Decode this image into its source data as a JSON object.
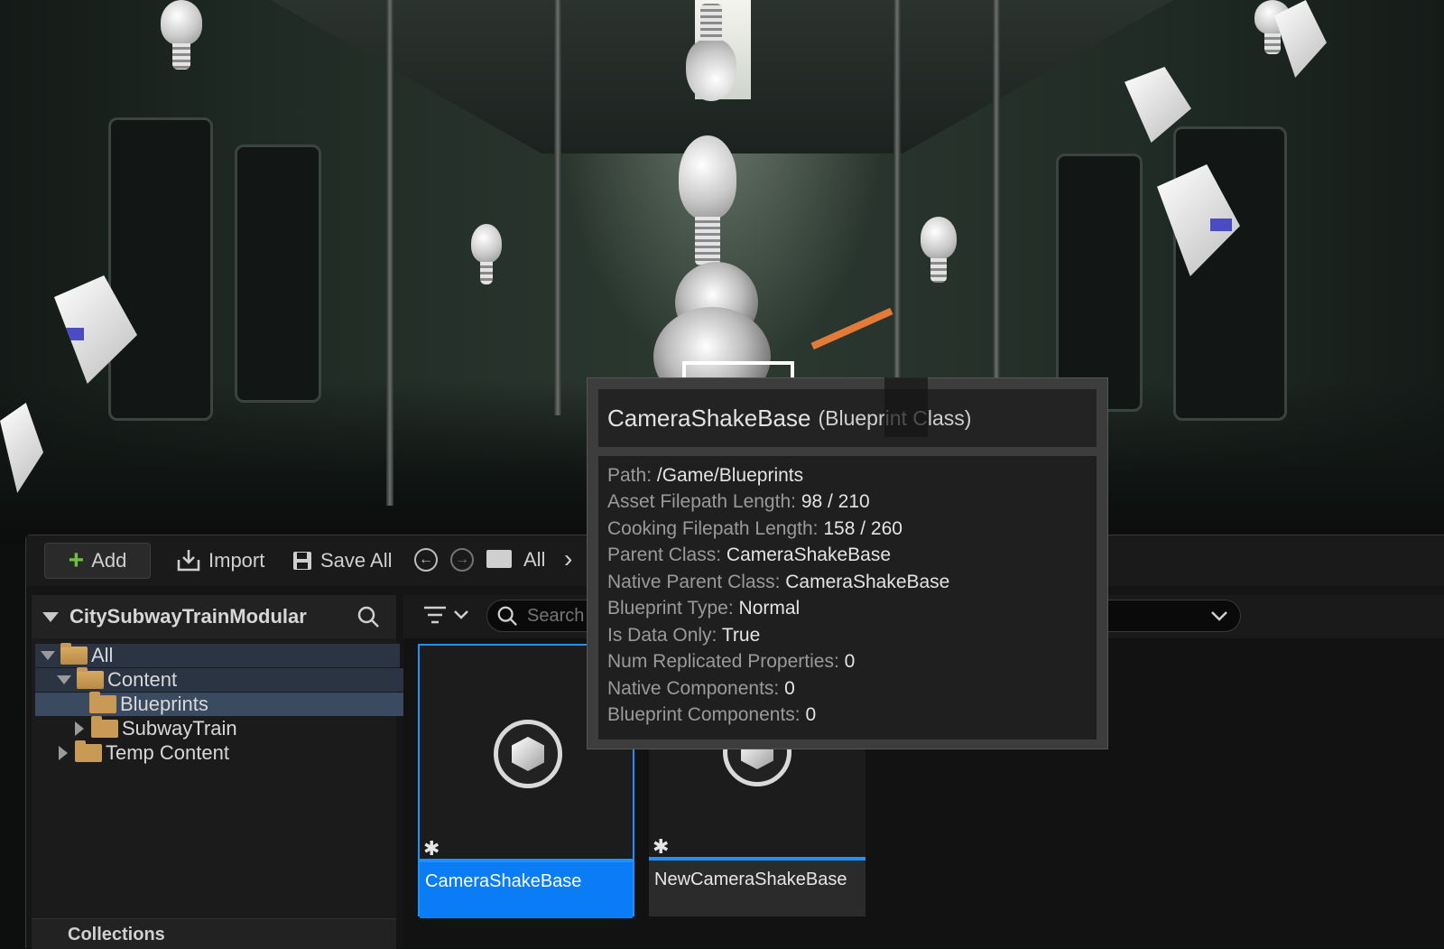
{
  "toolbar": {
    "add_label": "Add",
    "import_label": "Import",
    "save_all_label": "Save All",
    "path_root": "All",
    "chevron": "›"
  },
  "sources": {
    "title": "CitySubwayTrainModular",
    "tree": [
      {
        "label": "All",
        "expanded": true
      },
      {
        "label": "Content",
        "expanded": true
      },
      {
        "label": "Blueprints",
        "selected": true
      },
      {
        "label": "SubwayTrain",
        "expanded": false
      },
      {
        "label": "Temp Content",
        "expanded": false
      }
    ],
    "collections_label": "Collections"
  },
  "assets": {
    "search_placeholder": "Search Blueprints",
    "tiles": [
      {
        "name": "CameraShakeBase",
        "selected": true
      },
      {
        "name": "NewCameraShakeBase",
        "selected": false
      }
    ]
  },
  "tooltip": {
    "title": "CameraShakeBase",
    "type": "(Blueprint Class)",
    "rows": [
      {
        "key": "Path:",
        "value": "/Game/Blueprints"
      },
      {
        "key": "Asset Filepath Length:",
        "value": "98 / 210"
      },
      {
        "key": "Cooking Filepath Length:",
        "value": "158 / 260"
      },
      {
        "key": "Parent Class:",
        "value": "CameraShakeBase"
      },
      {
        "key": "Native Parent Class:",
        "value": "CameraShakeBase"
      },
      {
        "key": "Blueprint Type:",
        "value": "Normal"
      },
      {
        "key": "Is Data Only:",
        "value": "True"
      },
      {
        "key": "Num Replicated Properties:",
        "value": "0"
      },
      {
        "key": "Native Components:",
        "value": "0"
      },
      {
        "key": "Blueprint Components:",
        "value": "0"
      }
    ]
  },
  "icons": {
    "add": "plus-icon",
    "import": "import-icon",
    "save": "save-icon",
    "back": "back-arrow-icon",
    "forward": "forward-arrow-icon",
    "folder": "folder-icon",
    "search": "search-icon",
    "filter": "filter-icon",
    "dropdown": "chevron-down-icon",
    "blueprint": "blueprint-class-icon"
  },
  "colors": {
    "accent": "#0a7cf5",
    "selection": "#3a4a60",
    "add_green": "#6fc23b",
    "folder": "#c99a55"
  }
}
